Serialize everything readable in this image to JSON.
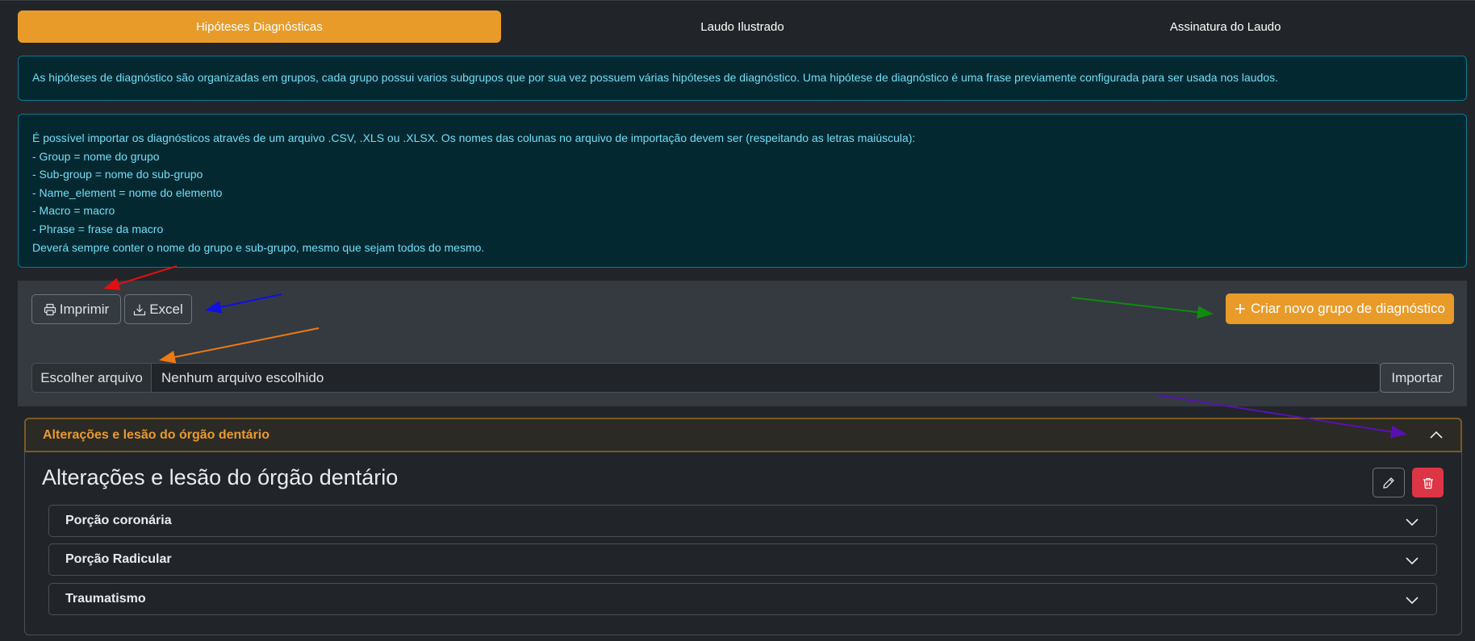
{
  "tabs": [
    {
      "label": "Hipóteses Diagnósticas",
      "active": true
    },
    {
      "label": "Laudo Ilustrado",
      "active": false
    },
    {
      "label": "Assinatura do Laudo",
      "active": false
    }
  ],
  "info": {
    "intro": "As hipóteses de diagnóstico são organizadas em grupos, cada grupo possui varios subgrupos que por sua vez possuem várias hipóteses de diagnóstico. Uma hipótese de diagnóstico é uma frase previamente configurada para ser usada nos laudos.",
    "import_lines": [
      "É possível importar os diagnósticos através de um arquivo .CSV, .XLS ou .XLSX. Os nomes das colunas no arquivo de importação devem ser (respeitando as letras maiúscula):",
      "- Group = nome do grupo",
      "- Sub-group = nome do sub-grupo",
      "- Name_element = nome do elemento",
      "- Macro = macro",
      "- Phrase = frase da macro",
      "Deverá sempre conter o nome do grupo e sub-grupo, mesmo que sejam todos do mesmo."
    ]
  },
  "toolbar": {
    "print_label": "Imprimir",
    "excel_label": "Excel",
    "new_group_label": "Criar novo grupo de diagnóstico",
    "choose_file_label": "Escolher arquivo",
    "file_status": "Nenhum arquivo escolhido",
    "import_label": "Importar"
  },
  "group": {
    "header": "Alterações e lesão do órgão dentário",
    "title": "Alterações e lesão do órgão dentário",
    "subgroups": [
      "Porção coronária",
      "Porção Radicular",
      "Traumatismo"
    ]
  },
  "icons": {
    "print": "printer-icon",
    "excel": "download-icon",
    "plus": "plus-icon",
    "edit": "pencil-icon",
    "delete": "trash-icon",
    "chevron_up": "chevron-up-icon",
    "chevron_down": "chevron-down-icon"
  },
  "colors": {
    "accent": "#e99b2a",
    "info_bg": "#032830",
    "info_text": "#6edff6",
    "danger": "#dc3545",
    "arrow_red": "#e01010",
    "arrow_blue": "#1010e0",
    "arrow_orange": "#f07a10",
    "arrow_green": "#108a10",
    "arrow_purple": "#5a10b0"
  }
}
